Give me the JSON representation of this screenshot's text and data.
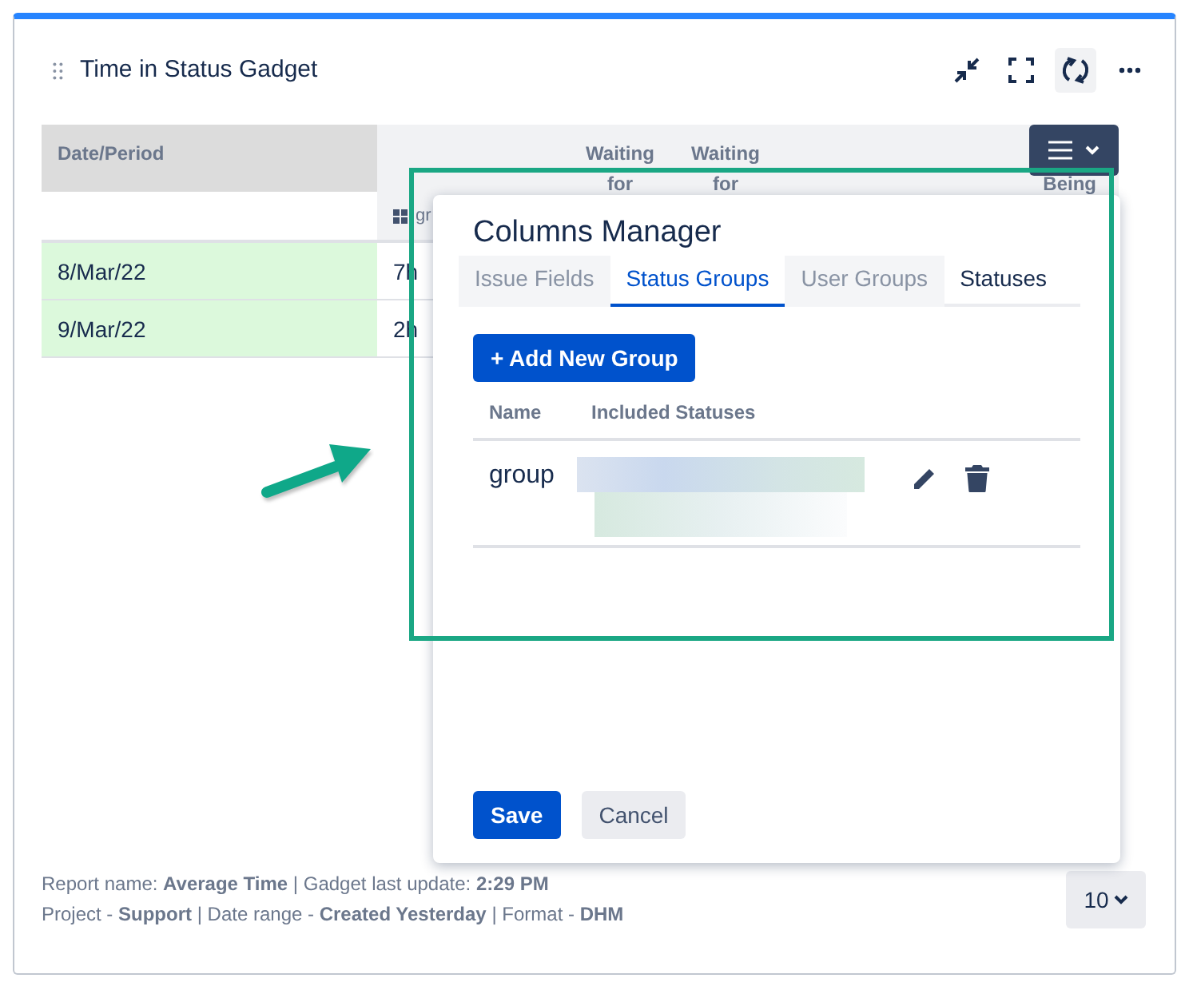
{
  "gadget": {
    "title": "Time in Status Gadget"
  },
  "table": {
    "columns": [
      {
        "label": "Date/Period"
      },
      {
        "label": "Waiting for"
      },
      {
        "label": "Waiting for"
      },
      {
        "label": "Being"
      }
    ],
    "subheader": "gr",
    "rows": [
      {
        "date": "8/Mar/22",
        "value": "7h"
      },
      {
        "date": "9/Mar/22",
        "value": "2h"
      }
    ]
  },
  "columns_manager": {
    "title": "Columns Manager",
    "tabs": [
      {
        "label": "Issue Fields",
        "selected": false,
        "disabled": true
      },
      {
        "label": "Status Groups",
        "selected": true,
        "disabled": false
      },
      {
        "label": "User Groups",
        "selected": false,
        "disabled": true
      },
      {
        "label": "Statuses",
        "selected": false,
        "disabled": false
      }
    ],
    "add_button": "+ Add New Group",
    "columns": [
      "Name",
      "Included Statuses"
    ],
    "groups": [
      {
        "name": "group"
      }
    ],
    "buttons": [
      {
        "label": "Save",
        "kind": "primary"
      },
      {
        "label": "Cancel",
        "kind": "secondary"
      }
    ]
  },
  "footer": {
    "lines": [
      "Report name: **Average Time** | Gadget last update: **2:29 PM**",
      "Project - **Support** | Date range - **Created Yesterday** | Format - **DHM**"
    ]
  },
  "page_size": "10"
}
